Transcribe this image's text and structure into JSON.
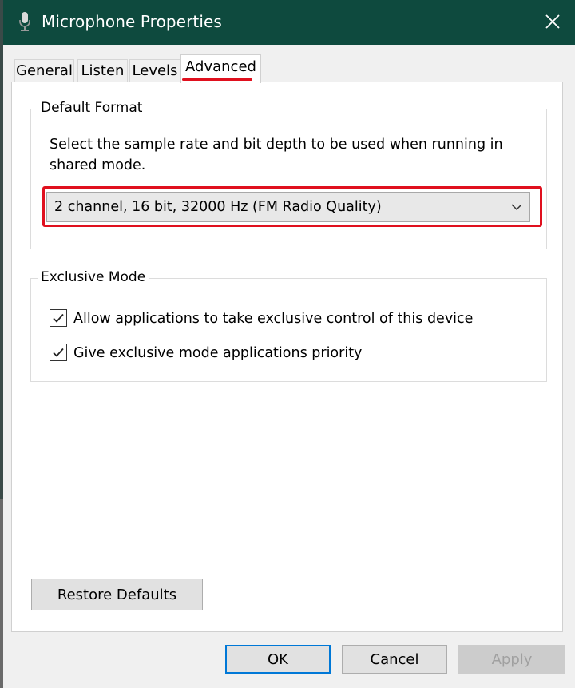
{
  "window": {
    "title": "Microphone Properties"
  },
  "tabs": [
    {
      "label": "General"
    },
    {
      "label": "Listen"
    },
    {
      "label": "Levels"
    },
    {
      "label": "Advanced",
      "selected": true
    }
  ],
  "default_format": {
    "title": "Default Format",
    "description": "Select the sample rate and bit depth to be used when running in shared mode.",
    "selected_value": "2 channel, 16 bit, 32000 Hz (FM Radio Quality)"
  },
  "exclusive_mode": {
    "title": "Exclusive Mode",
    "options": [
      {
        "label": "Allow applications to take exclusive control of this device",
        "checked": true
      },
      {
        "label": "Give exclusive mode applications priority",
        "checked": true
      }
    ]
  },
  "buttons": {
    "restore_defaults": "Restore Defaults",
    "ok": "OK",
    "cancel": "Cancel",
    "apply": "Apply"
  },
  "colors": {
    "titlebar": "#0e4a3e",
    "highlight": "#e0101e",
    "focus": "#0078d7"
  }
}
